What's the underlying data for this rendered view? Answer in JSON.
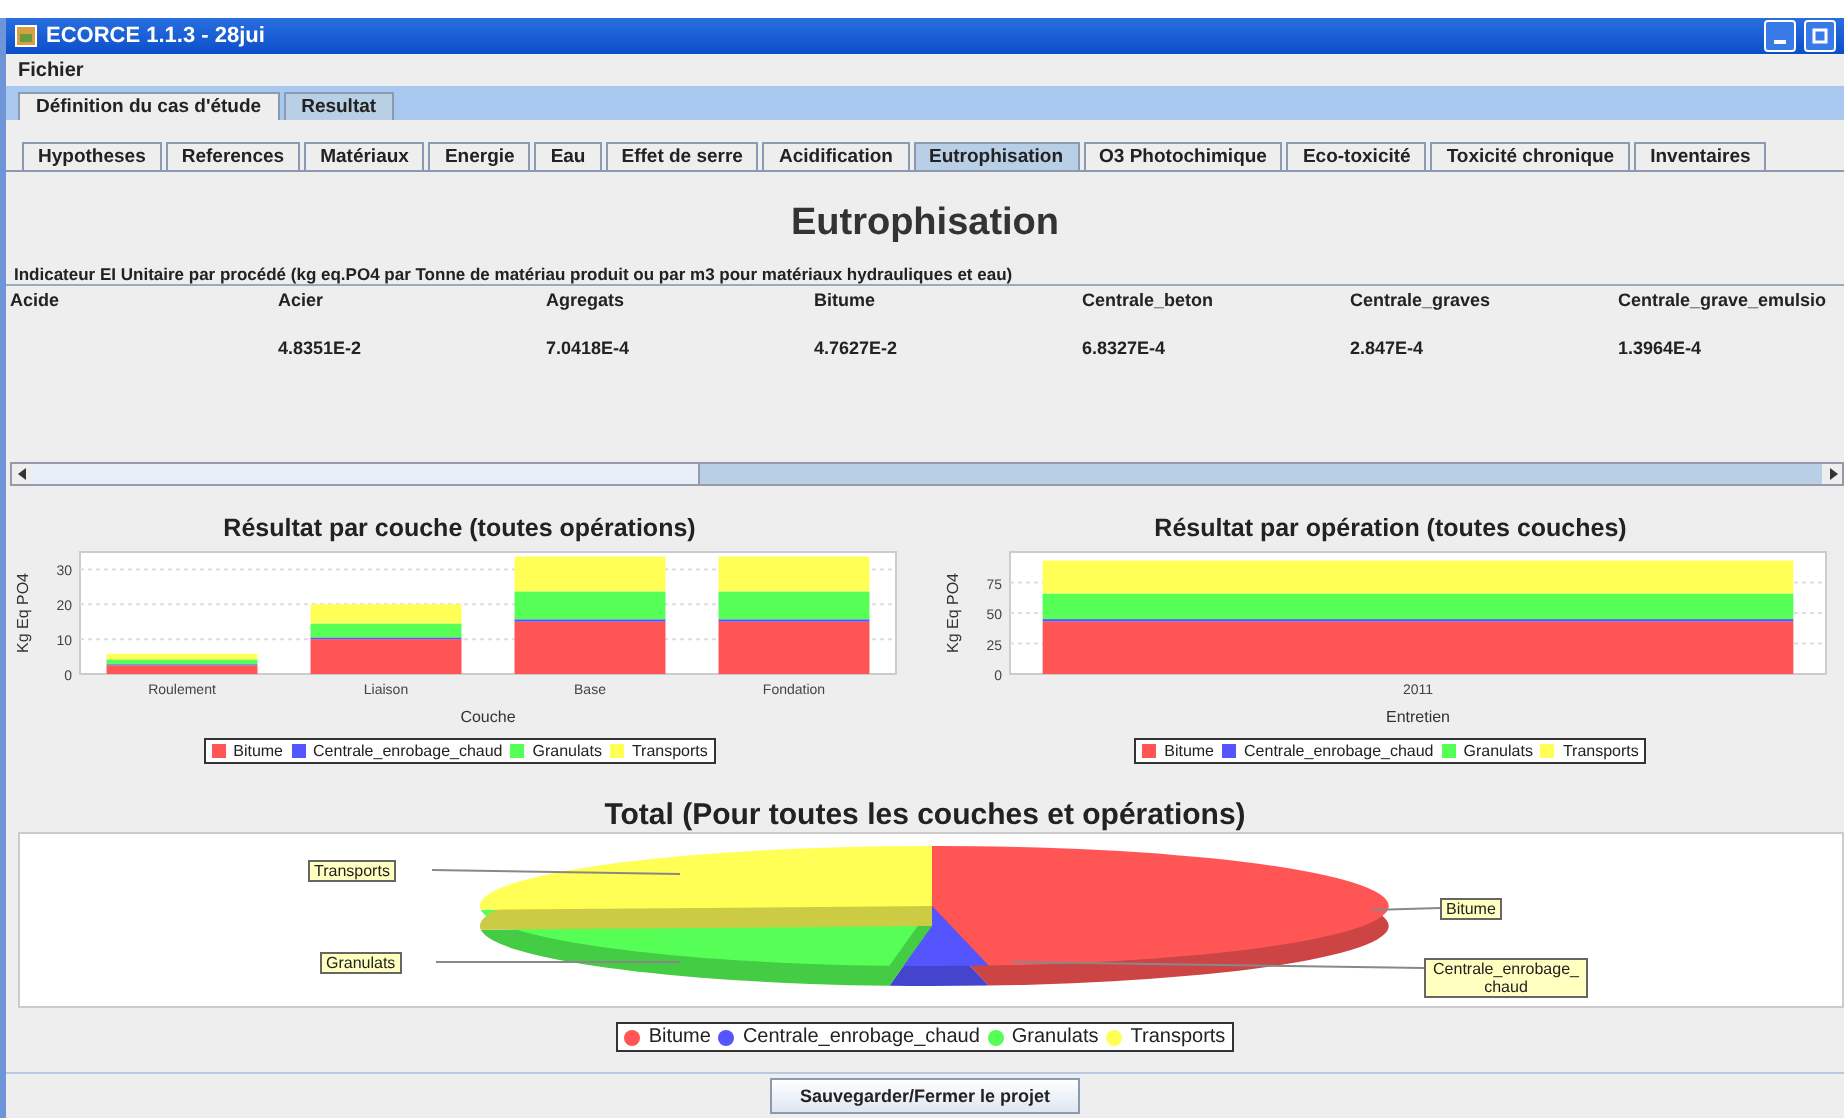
{
  "window": {
    "title": "ECORCE 1.1.3 - 28jui"
  },
  "menu": [
    "Fichier"
  ],
  "outer_tabs": [
    {
      "label": "Définition du cas d'étude",
      "selected": false
    },
    {
      "label": "Resultat",
      "selected": true
    }
  ],
  "inner_tabs": [
    {
      "label": "Hypotheses",
      "selected": false
    },
    {
      "label": "References",
      "selected": false
    },
    {
      "label": "Matériaux",
      "selected": false
    },
    {
      "label": "Energie",
      "selected": false
    },
    {
      "label": "Eau",
      "selected": false
    },
    {
      "label": "Effet de serre",
      "selected": false
    },
    {
      "label": "Acidification",
      "selected": false
    },
    {
      "label": "Eutrophisation",
      "selected": true
    },
    {
      "label": "O3 Photochimique",
      "selected": false
    },
    {
      "label": "Eco-toxicité",
      "selected": false
    },
    {
      "label": "Toxicité chronique",
      "selected": false
    },
    {
      "label": "Inventaires",
      "selected": false
    }
  ],
  "heading": "Eutrophisation",
  "table": {
    "caption": "Indicateur EI Unitaire par procédé (kg eq.PO4 par Tonne de matériau produit ou par m3 pour matériaux hydrauliques et eau)",
    "columns": [
      {
        "header": "Acide"
      },
      {
        "header": "Acier",
        "value": "4.8351E-2"
      },
      {
        "header": "Agregats",
        "value": "7.0418E-4"
      },
      {
        "header": "Bitume",
        "value": "4.7627E-2"
      },
      {
        "header": "Centrale_beton",
        "value": "6.8327E-4"
      },
      {
        "header": "Centrale_graves",
        "value": "2.847E-4"
      },
      {
        "header": "Centrale_grave_emulsio",
        "value": "1.3964E-4"
      }
    ]
  },
  "charts": [
    {
      "chart_data": {
        "type": "bar",
        "title": "Résultat par couche (toutes opérations)",
        "xlabel": "Couche",
        "ylabel": "Kg Eq PO4",
        "categories": [
          "Roulement",
          "Liaison",
          "Base",
          "Fondation"
        ],
        "stacked": true,
        "grid": true,
        "legend": true,
        "ylim": [
          0,
          35
        ],
        "yticks": [
          0,
          10,
          20,
          30
        ],
        "series": [
          {
            "name": "Bitume",
            "color": "#ff5555",
            "values": [
              2.5,
              10,
              15,
              15
            ]
          },
          {
            "name": "Centrale_enrobage_chaud",
            "color": "#5555ff",
            "values": [
              0.3,
              0.5,
              0.7,
              0.7
            ]
          },
          {
            "name": "Granulats",
            "color": "#55ff55",
            "values": [
              1.4,
              4,
              8,
              8
            ]
          },
          {
            "name": "Transports",
            "color": "#ffff55",
            "values": [
              1.6,
              5.5,
              10,
              10
            ]
          }
        ]
      }
    },
    {
      "chart_data": {
        "type": "bar",
        "title": "Résultat par opération (toutes couches)",
        "xlabel": "Entretien",
        "ylabel": "Kg Eq PO4",
        "categories": [
          "2011"
        ],
        "stacked": true,
        "grid": true,
        "legend": true,
        "ylim": [
          0,
          100
        ],
        "yticks": [
          0,
          25,
          50,
          75
        ],
        "series": [
          {
            "name": "Bitume",
            "color": "#ff5555",
            "values": [
              43
            ]
          },
          {
            "name": "Centrale_enrobage_chaud",
            "color": "#5555ff",
            "values": [
              2
            ]
          },
          {
            "name": "Granulats",
            "color": "#55ff55",
            "values": [
              21
            ]
          },
          {
            "name": "Transports",
            "color": "#ffff55",
            "values": [
              27
            ]
          }
        ]
      }
    }
  ],
  "total": {
    "title": "Total (Pour toutes les couches et opérations)",
    "slices": [
      {
        "callout": "Bitume",
        "legend": "Bitume",
        "color": "#ff5555"
      },
      {
        "callout": "Centrale_enrobage_chaud",
        "legend": "Centrale_enrobage_chaud",
        "color": "#5555ff"
      },
      {
        "callout": "Granulats",
        "legend": "Granulats",
        "color": "#55ff55"
      },
      {
        "callout": "Transports",
        "legend": "Transports",
        "color": "#ffff55"
      }
    ]
  },
  "save_button": "Sauvegarder/Fermer le projet"
}
